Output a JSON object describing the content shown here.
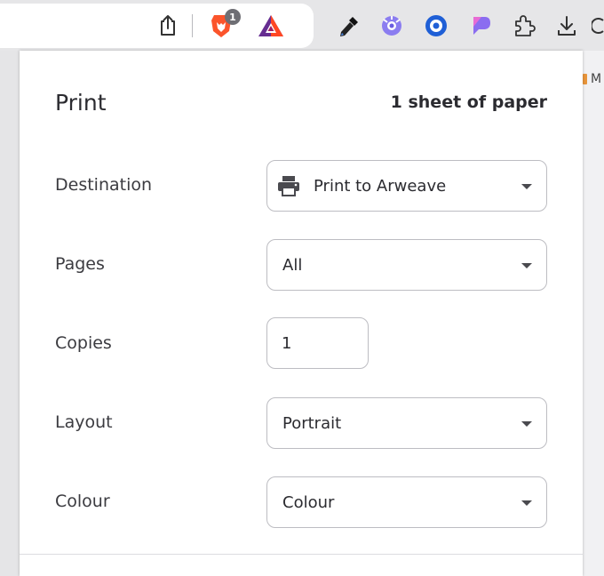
{
  "toolbar": {
    "extension_badge": "1",
    "icons": [
      "share-icon",
      "brave-shields-icon",
      "bat-rewards-icon",
      "color-picker-icon",
      "extension-icon",
      "extension-icon",
      "extension-icon",
      "puzzle-icon",
      "download-icon"
    ]
  },
  "bookmark_fragment": "M",
  "print": {
    "title": "Print",
    "sheets": "1 sheet of paper",
    "destination": {
      "label": "Destination",
      "value": "Print to Arweave"
    },
    "pages": {
      "label": "Pages",
      "value": "All"
    },
    "copies": {
      "label": "Copies",
      "value": "1"
    },
    "layout": {
      "label": "Layout",
      "value": "Portrait"
    },
    "colour": {
      "label": "Colour",
      "value": "Colour"
    }
  },
  "colors": {
    "brave_orange": "#fb542b",
    "bat_purple": "#662d91",
    "bat_red": "#ff4724",
    "accent_blue": "#1f5fd6",
    "ext_purple": "#8b6df0"
  }
}
